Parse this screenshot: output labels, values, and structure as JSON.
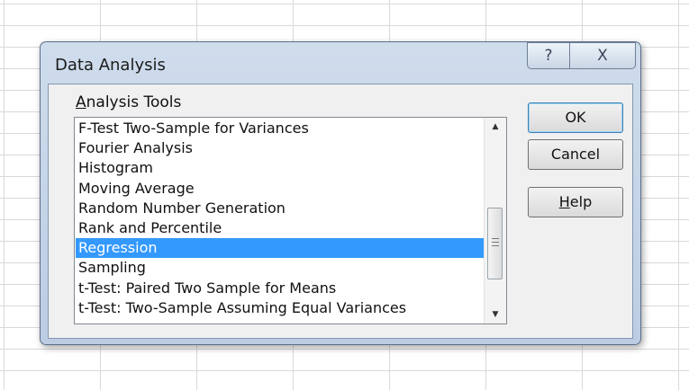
{
  "dialog": {
    "title": "Data Analysis",
    "help_glyph": "?",
    "close_glyph": "X",
    "group_label_accel": "A",
    "group_label_rest": "nalysis Tools",
    "list_items": [
      "F-Test Two-Sample for Variances",
      "Fourier Analysis",
      "Histogram",
      "Moving Average",
      "Random Number Generation",
      "Rank and Percentile",
      "Regression",
      "Sampling",
      "t-Test: Paired Two Sample for Means",
      "t-Test: Two-Sample Assuming Equal Variances"
    ],
    "selected_item": "Regression",
    "scroll_up_glyph": "▲",
    "scroll_down_glyph": "▼",
    "ok_label": "OK",
    "cancel_label": "Cancel",
    "help_label_accel": "H",
    "help_label_rest": "elp"
  }
}
